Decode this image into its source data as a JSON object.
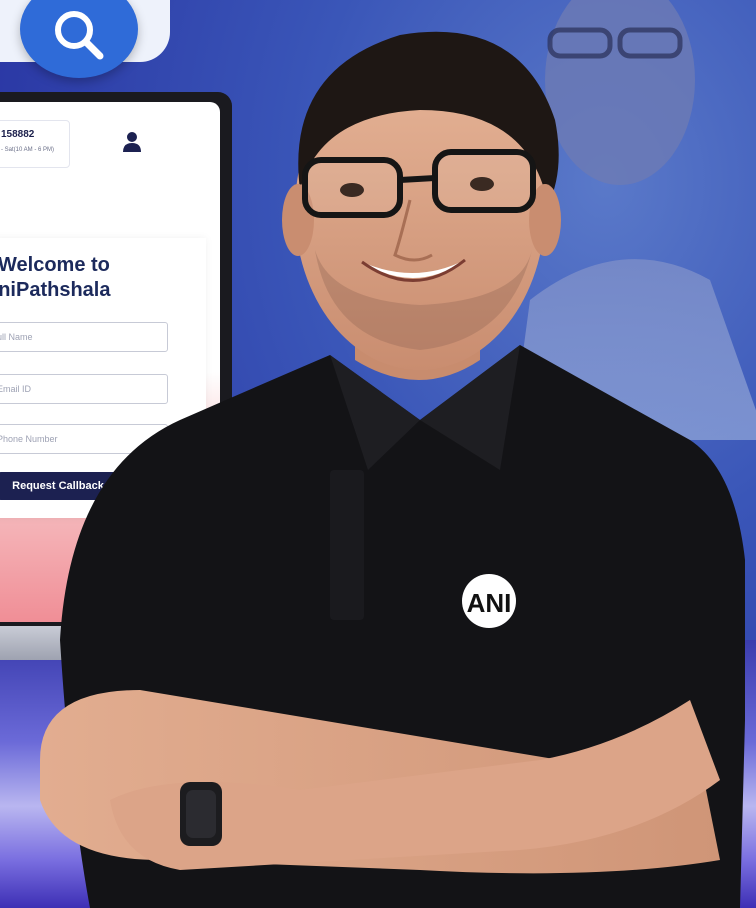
{
  "search": {
    "icon": "search-icon",
    "color": "#2f6bd8"
  },
  "website": {
    "contact_phone": "158882",
    "contact_hours": "- Sat(10 AM - 6 PM)",
    "welcome_line1": "Welcome to",
    "welcome_line2": "pniPathshala",
    "fields": {
      "full_name_placeholder": "ull Name",
      "email_placeholder": "Email ID",
      "phone_placeholder": "Phone Number"
    },
    "request_callback_label": "Request Callback"
  },
  "shirt_logo_text": "ANI",
  "colors": {
    "background": "#2c3aa6",
    "cta": "#1c2151",
    "heading": "#1c2a5c"
  }
}
